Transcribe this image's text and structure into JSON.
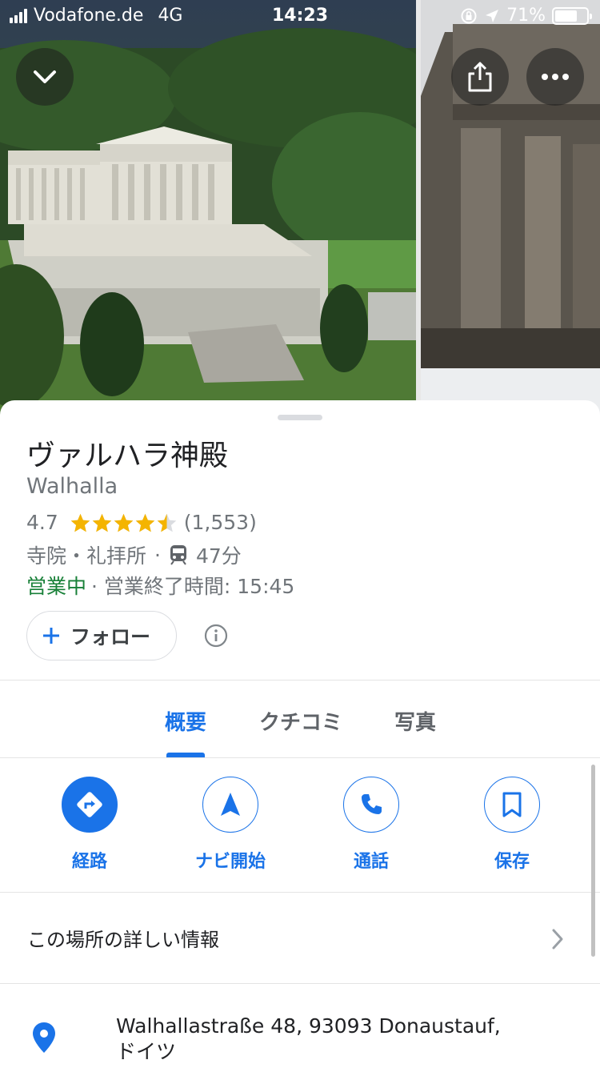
{
  "status_bar": {
    "carrier": "Vodafone.de",
    "network": "4G",
    "time": "14:23",
    "battery_percent": "71%",
    "battery_level": 0.71
  },
  "top_buttons": {
    "collapse_icon": "chevron-down-icon",
    "share_icon": "share-icon",
    "more_icon": "more-horizontal-icon"
  },
  "place": {
    "title": "ヴァルハラ神殿",
    "subtitle": "Walhalla",
    "rating": "4.7",
    "stars_value": 4.7,
    "review_count": "(1,553)",
    "category": "寺院・礼拝所",
    "separator": "·",
    "transit_time": "47分",
    "open_status": "営業中",
    "hours_text": "· 営業終了時間: 15:45"
  },
  "follow": {
    "label": "フォロー"
  },
  "tabs": [
    {
      "label": "概要",
      "active": true
    },
    {
      "label": "クチコミ",
      "active": false
    },
    {
      "label": "写真",
      "active": false
    }
  ],
  "actions": [
    {
      "label": "経路",
      "icon": "directions-icon"
    },
    {
      "label": "ナビ開始",
      "icon": "navigation-arrow-icon"
    },
    {
      "label": "通話",
      "icon": "phone-icon"
    },
    {
      "label": "保存",
      "icon": "bookmark-icon"
    }
  ],
  "details": {
    "label": "この場所の詳しい情報"
  },
  "address": {
    "line1": "Walhallastraße 48, 93093 Donaustauf,",
    "line2": "ドイツ"
  },
  "colors": {
    "accent": "#1a73e8",
    "open_green": "#188038",
    "star": "#f4b400"
  }
}
